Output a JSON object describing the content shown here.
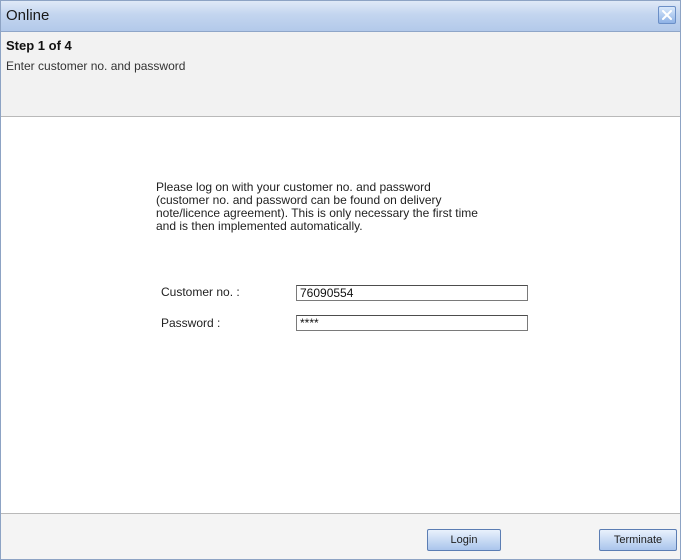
{
  "window": {
    "title": "Online"
  },
  "header": {
    "step": "Step 1 of 4",
    "subtitle": "Enter customer no. and password"
  },
  "content": {
    "instruction_lines": [
      "Please log on with your customer no. and password",
      "(customer no. and password can be found on delivery",
      "note/licence agreement). This is only necessary the first time",
      "and is then implemented automatically."
    ],
    "customer_label": "Customer no. :",
    "customer_value": "76090554",
    "password_label": "Password :",
    "password_value": "****"
  },
  "footer": {
    "login_label": "Login",
    "terminate_label": "Terminate"
  },
  "icons": {
    "close": "close-icon"
  }
}
